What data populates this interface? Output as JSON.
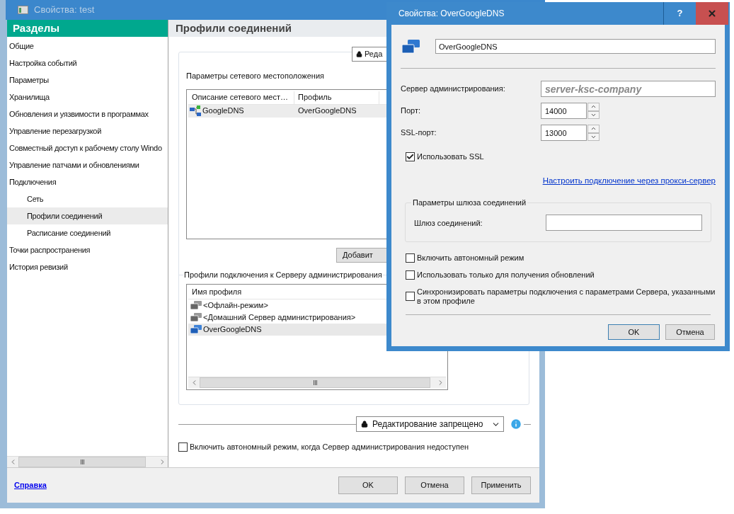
{
  "main_window": {
    "title": "Свойства: test",
    "sidebar": {
      "header": "Разделы",
      "items": [
        {
          "label": "Общие",
          "selected": false
        },
        {
          "label": "Настройка событий",
          "selected": false
        },
        {
          "label": "Параметры",
          "selected": false
        },
        {
          "label": "Хранилища",
          "selected": false
        },
        {
          "label": "Обновления и уязвимости в программах",
          "selected": false
        },
        {
          "label": "Управление перезагрузкой",
          "selected": false
        },
        {
          "label": "Совместный доступ к рабочему столу Windo",
          "selected": false
        },
        {
          "label": "Управление патчами и обновлениями",
          "selected": false
        },
        {
          "label": "Подключения",
          "selected": false,
          "children": [
            {
              "label": "Сеть",
              "selected": false
            },
            {
              "label": "Профили соединений",
              "selected": true
            },
            {
              "label": "Расписание соединений",
              "selected": false
            }
          ]
        },
        {
          "label": "Точки распространения",
          "selected": false
        },
        {
          "label": "История ревизий",
          "selected": false
        }
      ]
    },
    "page_title": "Профили соединений",
    "lock_button": "Реда",
    "location_section": {
      "label": "Параметры сетевого местоположения",
      "columns": [
        "Описание сетевого мест…",
        "Профиль"
      ],
      "rows": [
        {
          "cells": [
            "GoogleDNS",
            "OverGoogleDNS"
          ],
          "selected": true
        }
      ]
    },
    "add_button": "Добавит",
    "profiles_section": {
      "label": "Профили подключения к Серверу администрирования",
      "column": "Имя профиля",
      "rows": [
        {
          "name": "<Офлайн-режим>",
          "kind": "builtin",
          "selected": false
        },
        {
          "name": "<Домашний Сервер администрирования>",
          "kind": "builtin",
          "selected": false
        },
        {
          "name": "OverGoogleDNS",
          "kind": "custom",
          "selected": true
        }
      ]
    },
    "policy_dropdown": "Редактирование запрещено",
    "offline_checkbox": {
      "label": "Включить автономный режим, когда Сервер администрирования недоступен",
      "checked": false
    },
    "help_link": "Справка",
    "buttons": [
      "OK",
      "Отмена",
      "Применить"
    ]
  },
  "dialog": {
    "title": "Свойства: OverGoogleDNS",
    "help_button": "?",
    "profile_name": "OverGoogleDNS",
    "server": {
      "label": "Сервер администрирования:",
      "placeholder": "server-ksc-company"
    },
    "port": {
      "label": "Порт:",
      "value": "14000"
    },
    "ssl_port": {
      "label": "SSL-порт:",
      "value": "13000"
    },
    "use_ssl": {
      "label": "Использовать SSL",
      "checked": true
    },
    "proxy_link": "Настроить подключение через прокси-сервер",
    "gateway": {
      "title": "Параметры шлюза соединений",
      "label": "Шлюз соединений:"
    },
    "options": [
      {
        "label": "Включить автономный режим",
        "checked": false
      },
      {
        "label": "Использовать только для получения обновлений",
        "checked": false
      },
      {
        "label": "Синхронизировать параметры подключения с параметрами Сервера, указанными в этом профиле",
        "checked": false
      }
    ],
    "buttons": [
      {
        "label": "OK",
        "default": true
      },
      {
        "label": "Отмена",
        "default": false
      }
    ]
  }
}
